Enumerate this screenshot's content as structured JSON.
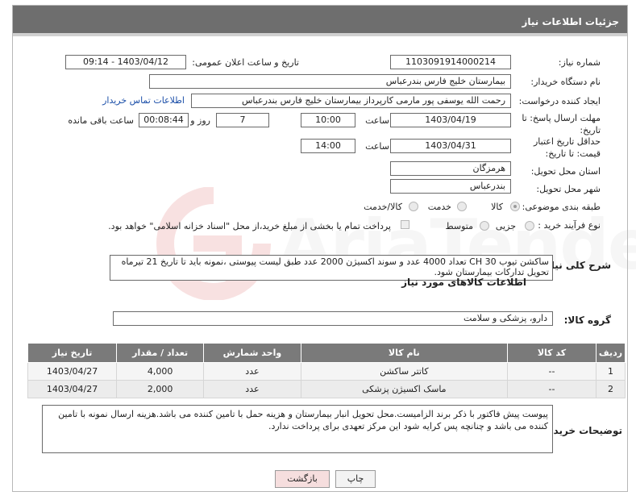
{
  "header": {
    "title": "جزئیات اطلاعات نیاز"
  },
  "fields": {
    "need_number_label": "شماره نیاز:",
    "need_number": "1103091914000214",
    "announce_label": "تاریخ و ساعت اعلان عمومی:",
    "announce_value": "1403/04/12 - 09:14",
    "buyer_org_label": "نام دستگاه خریدار:",
    "buyer_org": "بیمارستان خلیج فارس بندرعباس",
    "requester_label": "ایجاد کننده درخواست:",
    "requester": "رحمت الله یوسفی پور مارمی کارپرداز بیمارستان خلیج فارس بندرعباس",
    "contact_link": "اطلاعات تماس خریدار",
    "deadline_label": "مهلت ارسال پاسخ: تا تاریخ:",
    "deadline_date": "1403/04/19",
    "time_word": "ساعت",
    "deadline_time": "10:00",
    "days_value": "7",
    "days_word": "روز و",
    "remaining_time": "00:08:44",
    "remaining_word": "ساعت باقی مانده",
    "validity_label": "حداقل تاریخ اعتبار قیمت: تا تاریخ:",
    "validity_date": "1403/04/31",
    "validity_time": "14:00",
    "province_label": "استان محل تحویل:",
    "province": "هرمزگان",
    "city_label": "شهر محل تحویل:",
    "city": "بندرعباس",
    "category_label": "طبقه بندی موضوعی:",
    "category_options": [
      "کالا",
      "خدمت",
      "کالا/خدمت"
    ],
    "process_label": "نوع فرآیند خرید :",
    "process_options": [
      "جزیی",
      "متوسط"
    ],
    "process_note": "پرداخت تمام یا بخشی از مبلغ خرید،از محل \"اسناد خزانه اسلامی\" خواهد بود."
  },
  "description": {
    "label": "شرح کلی نیاز:",
    "text": "ساکشن تیوب CH 30 تعداد 4000 عدد و سوند اکسیژن 2000 عدد طبق لیست پیوستی ،نمونه باید تا تاریخ 21 تیرماه تحویل تدارکات بیمارستان شود."
  },
  "goods": {
    "section_title": "اطلاعات کالاهای مورد نیاز",
    "group_label": "گروه کالا:",
    "group_value": "دارو، پزشکی و سلامت",
    "columns": [
      "ردیف",
      "کد کالا",
      "نام کالا",
      "واحد شمارش",
      "تعداد / مقدار",
      "تاریخ نیاز"
    ],
    "rows": [
      [
        "1",
        "--",
        "کاتتر ساکشن",
        "عدد",
        "4,000",
        "1403/04/27"
      ],
      [
        "2",
        "--",
        "ماسک اکسیژن پزشکی",
        "عدد",
        "2,000",
        "1403/04/27"
      ]
    ]
  },
  "buyer_notes": {
    "label": "توضیحات خریدار:",
    "text": "پیوست پیش فاکتور با ذکر برند الزامیست.محل تحویل انبار بیمارستان و هزینه حمل با تامین کننده می باشد.هزینه ارسال نمونه با تامین کننده می باشد و چنانچه پس کرایه شود این مرکز تعهدی برای پرداخت ندارد."
  },
  "buttons": {
    "print": "چاپ",
    "back": "بازگشت"
  },
  "watermark": {
    "text": "AriaTender.net"
  },
  "colors": {
    "header_bg": "#6e6e6e",
    "table_header_bg": "#7a7a7a",
    "link": "#1a4ea8",
    "back_btn": "#f6dede"
  }
}
